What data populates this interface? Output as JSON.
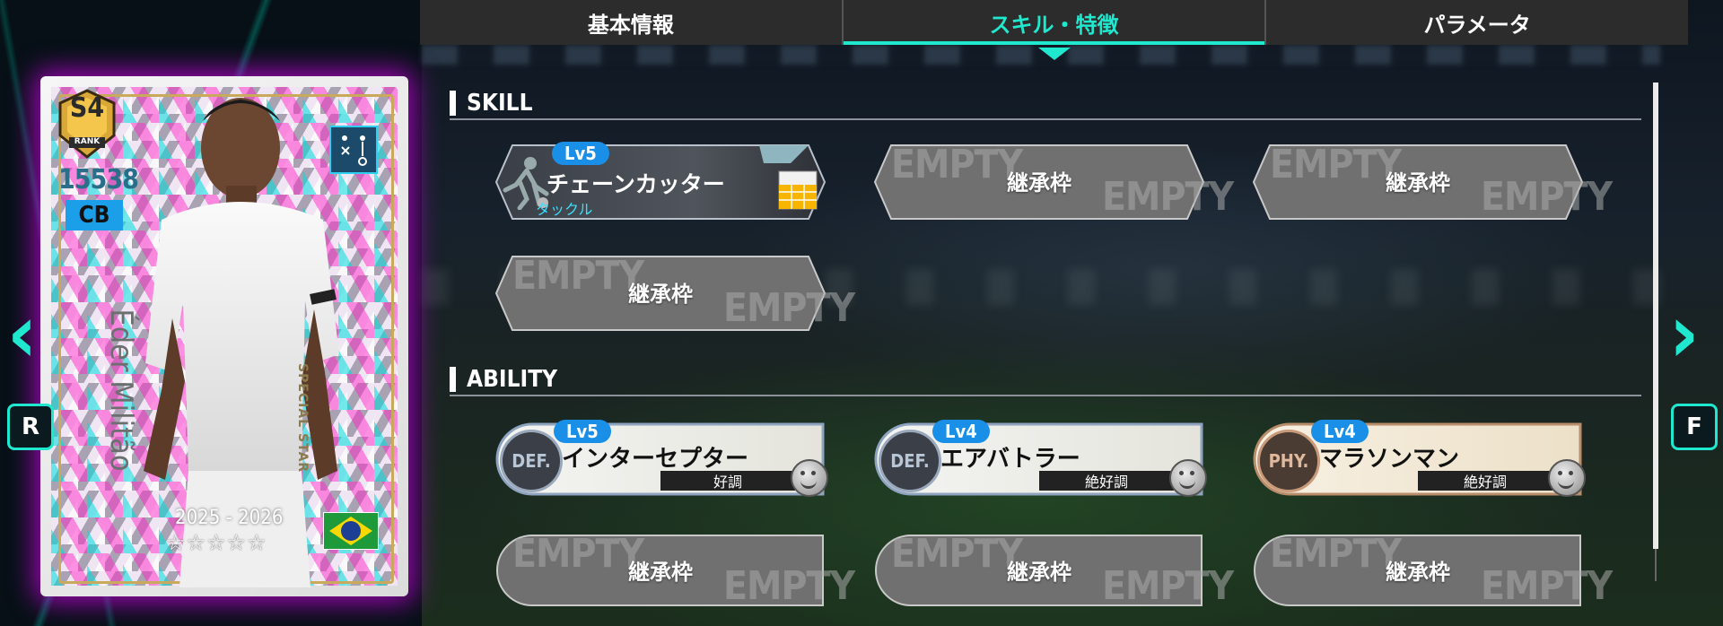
{
  "tabs": [
    {
      "label": "基本情報"
    },
    {
      "label": "スキル・特徴",
      "active": true
    },
    {
      "label": "パラメータ"
    }
  ],
  "sections": {
    "skill": "SKILL",
    "ability": "ABILITY"
  },
  "empty_text": "EMPTY",
  "inherit_label": "継承枠",
  "skill": {
    "level": "Lv5",
    "name": "チェーンカッター",
    "category": "タックル"
  },
  "abilities": [
    {
      "level": "Lv5",
      "badge": "DEF.",
      "name": "インターセプター",
      "condition": "好調"
    },
    {
      "level": "Lv4",
      "badge": "DEF.",
      "name": "エアバトラー",
      "condition": "絶好調"
    },
    {
      "level": "Lv4",
      "badge": "PHY.",
      "name": "マラソンマン",
      "condition": "絶好調"
    }
  ],
  "card": {
    "rank": "S4",
    "rank_label": "RANK",
    "rating": "15538",
    "position": "CB",
    "player_name": "Éder Militão",
    "type": "SPECIAL STAR",
    "season": "2025 - 2026",
    "stars": "☆☆☆☆☆",
    "nationality_flag": "brazil"
  },
  "nav": {
    "left_key": "R",
    "right_key": "F"
  },
  "colors": {
    "accent": "#1fe8cf",
    "level_pill": "#1a8fe8",
    "card_glow": "#e600ff"
  }
}
